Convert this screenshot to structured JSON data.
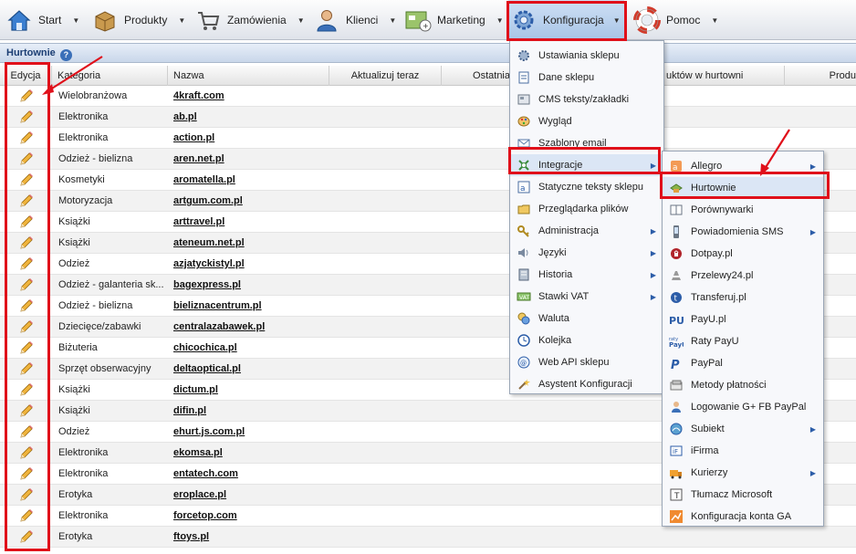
{
  "menubar": {
    "items": [
      {
        "label": "Start",
        "icon": "home-icon"
      },
      {
        "label": "Produkty",
        "icon": "box-icon"
      },
      {
        "label": "Zamówienia",
        "icon": "cart-icon"
      },
      {
        "label": "Klienci",
        "icon": "user-icon"
      },
      {
        "label": "Marketing",
        "icon": "marketing-icon"
      },
      {
        "label": "Konfiguracja",
        "icon": "gear-icon"
      },
      {
        "label": "Pomoc",
        "icon": "lifebuoy-icon"
      }
    ]
  },
  "panel": {
    "title": "Hurtownie"
  },
  "table": {
    "headers": [
      "Edycja",
      "Kategoria",
      "Nazwa",
      "Aktualizuj teraz",
      "Ostatnia",
      "uktów w hurtowni",
      "Produ"
    ],
    "rows": [
      {
        "category": "Wielobranżowa",
        "name": "4kraft.com"
      },
      {
        "category": "Elektronika",
        "name": "ab.pl"
      },
      {
        "category": "Elektronika",
        "name": "action.pl"
      },
      {
        "category": "Odzież - bielizna",
        "name": "aren.net.pl"
      },
      {
        "category": "Kosmetyki",
        "name": "aromatella.pl"
      },
      {
        "category": "Motoryzacja",
        "name": "artgum.com.pl"
      },
      {
        "category": "Książki",
        "name": "arttravel.pl"
      },
      {
        "category": "Książki",
        "name": "ateneum.net.pl"
      },
      {
        "category": "Odzież",
        "name": "azjatyckistyl.pl"
      },
      {
        "category": "Odzież - galanteria sk...",
        "name": "bagexpress.pl"
      },
      {
        "category": "Odzież - bielizna",
        "name": "bieliznacentrum.pl"
      },
      {
        "category": "Dziecięce/zabawki",
        "name": "centralazabawek.pl"
      },
      {
        "category": "Biżuteria",
        "name": "chicochica.pl"
      },
      {
        "category": "Sprzęt obserwacyjny",
        "name": "deltaoptical.pl"
      },
      {
        "category": "Książki",
        "name": "dictum.pl"
      },
      {
        "category": "Książki",
        "name": "difin.pl"
      },
      {
        "category": "Odzież",
        "name": "ehurt.js.com.pl"
      },
      {
        "category": "Elektronika",
        "name": "ekomsa.pl"
      },
      {
        "category": "Elektronika",
        "name": "entatech.com"
      },
      {
        "category": "Erotyka",
        "name": "eroplace.pl"
      },
      {
        "category": "Elektronika",
        "name": "forcetop.com"
      },
      {
        "category": "Erotyka",
        "name": "ftoys.pl"
      }
    ]
  },
  "config_menu": {
    "items": [
      {
        "label": "Ustawiania sklepu",
        "icon": "gear-small-icon",
        "sub": false
      },
      {
        "label": "Dane sklepu",
        "icon": "document-icon",
        "sub": false
      },
      {
        "label": "CMS teksty/zakładki",
        "icon": "cms-icon",
        "sub": false
      },
      {
        "label": "Wygląd",
        "icon": "palette-icon",
        "sub": false
      },
      {
        "label": "Szablony email",
        "icon": "envelope-icon",
        "sub": false
      },
      {
        "label": "Integracje",
        "icon": "integration-icon",
        "sub": true
      },
      {
        "label": "Statyczne teksty sklepu",
        "icon": "text-icon",
        "sub": false
      },
      {
        "label": "Przeglądarka plików",
        "icon": "folder-icon",
        "sub": false
      },
      {
        "label": "Administracja",
        "icon": "key-icon",
        "sub": true
      },
      {
        "label": "Języki",
        "icon": "speaker-icon",
        "sub": true
      },
      {
        "label": "Historia",
        "icon": "history-icon",
        "sub": true
      },
      {
        "label": "Stawki VAT",
        "icon": "vat-icon",
        "sub": true
      },
      {
        "label": "Waluta",
        "icon": "currency-icon",
        "sub": false
      },
      {
        "label": "Kolejka",
        "icon": "clock-icon",
        "sub": false
      },
      {
        "label": "Web API sklepu",
        "icon": "api-icon",
        "sub": false
      },
      {
        "label": "Asystent Konfiguracji",
        "icon": "wand-icon",
        "sub": false
      }
    ]
  },
  "integr_menu": {
    "items": [
      {
        "label": "Allegro",
        "icon": "allegro-icon",
        "sub": true
      },
      {
        "label": "Hurtownie",
        "icon": "wholesale-icon",
        "sub": false
      },
      {
        "label": "Porównywarki",
        "icon": "compare-icon",
        "sub": false
      },
      {
        "label": "Powiadomienia SMS",
        "icon": "phone-icon",
        "sub": true
      },
      {
        "label": "Dotpay.pl",
        "icon": "dotpay-icon",
        "sub": false
      },
      {
        "label": "Przelewy24.pl",
        "icon": "przelewy-icon",
        "sub": false
      },
      {
        "label": "Transferuj.pl",
        "icon": "transferuj-icon",
        "sub": false
      },
      {
        "label": "PayU.pl",
        "icon": "payu-icon",
        "sub": false
      },
      {
        "label": "Raty PayU",
        "icon": "raty-payu-icon",
        "sub": false
      },
      {
        "label": "PayPal",
        "icon": "paypal-icon",
        "sub": false
      },
      {
        "label": "Metody płatności",
        "icon": "payment-methods-icon",
        "sub": false
      },
      {
        "label": "Logowanie G+ FB PayPal",
        "icon": "login-icon",
        "sub": false
      },
      {
        "label": "Subiekt",
        "icon": "subiekt-icon",
        "sub": true
      },
      {
        "label": "iFirma",
        "icon": "ifirma-icon",
        "sub": false
      },
      {
        "label": "Kurierzy",
        "icon": "courier-icon",
        "sub": true
      },
      {
        "label": "Tłumacz Microsoft",
        "icon": "translator-icon",
        "sub": false
      },
      {
        "label": "Konfiguracja konta GA",
        "icon": "analytics-icon",
        "sub": false
      }
    ]
  },
  "colors": {
    "highlight": "#e0101a",
    "accent": "#1a3d73"
  }
}
